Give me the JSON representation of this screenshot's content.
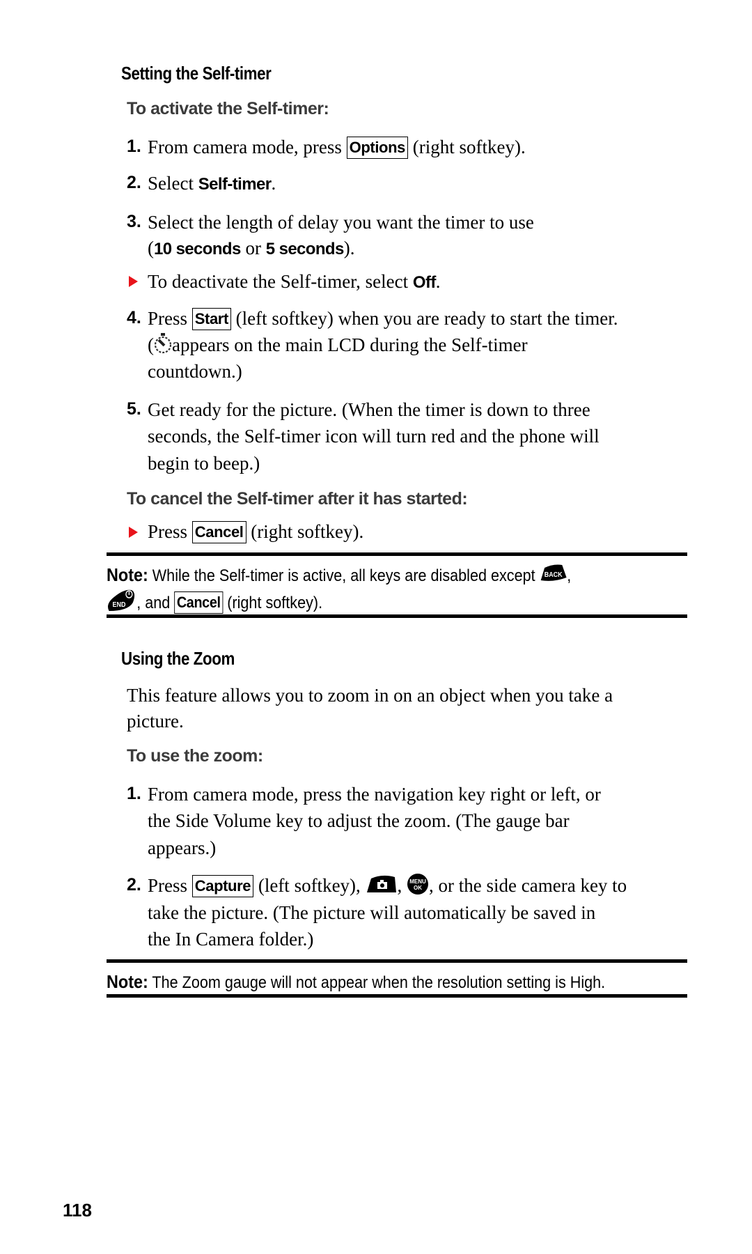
{
  "page_number": "118",
  "colors": {
    "bullet": "#e8141b",
    "subheading": "#3b3b3b"
  },
  "section1": {
    "title": "Setting the Self-timer",
    "subheading": "To activate the Self-timer:",
    "steps": [
      {
        "num": "1.",
        "pre": "From camera mode, press",
        "key": "Options",
        "post": "(right softkey)."
      },
      {
        "num": "2.",
        "pre": "Select",
        "bold": "Self-timer",
        "post": "."
      },
      {
        "num": "3.",
        "line1": "Select the length of delay you want the timer to use",
        "open": "(",
        "opt1": "10 seconds",
        "or": "or",
        "opt2": "5 seconds",
        "close": ")."
      },
      {
        "num": "4.",
        "pre": "Press",
        "key": "Start",
        "post": "(left softkey) when you are ready to start the timer.",
        "line2_open": "(",
        "icon": "self-timer-icon",
        "line2": "appears on the main LCD during the Self-timer",
        "line3": "countdown.)"
      },
      {
        "num": "5.",
        "line1": "Get ready for the picture. (When the timer is down to three",
        "line2": "seconds, the Self-timer icon will turn red and the phone will",
        "line3": "begin to beep.)"
      }
    ],
    "bullet_deactivate": {
      "pre": "To deactivate the Self-timer, select",
      "bold": "Off",
      "post": "."
    },
    "cancel_subheading": "To cancel the Self-timer after it has started:",
    "bullet_cancel": {
      "pre": "Press",
      "key": "Cancel",
      "post": "(right softkey)."
    },
    "note": {
      "label": "Note:",
      "text1": "While the Self-timer is active, all keys are disabled except",
      "back_key": "BACK",
      "end_key": "END",
      "text2": ", and",
      "key": "Cancel",
      "text3": "(right softkey)."
    }
  },
  "section2": {
    "title": "Using the Zoom",
    "intro_line1": "This feature allows you to zoom in on an object when you take a",
    "intro_line2": "picture.",
    "subheading": "To use the zoom:",
    "steps": [
      {
        "num": "1.",
        "line1": "From camera mode, press the navigation key right or left, or",
        "line2": "the Side Volume key to adjust the zoom. (The gauge bar",
        "line3": "appears.)"
      },
      {
        "num": "2.",
        "pre": "Press",
        "key": "Capture",
        "post": "(left softkey),",
        "menu_top": "MENU",
        "menu_bottom": "OK",
        "post2": ", or the side camera key to",
        "line2": "take the picture. (The picture will automatically be saved in",
        "line3": "the In Camera folder.)"
      }
    ],
    "note": {
      "label": "Note:",
      "text": "The Zoom gauge will not appear when the resolution setting is High."
    }
  }
}
